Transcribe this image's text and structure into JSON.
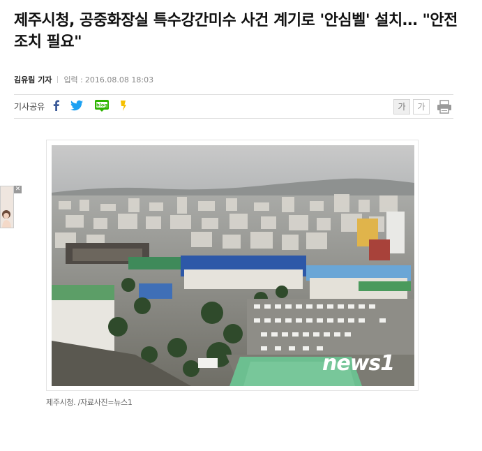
{
  "article": {
    "title": "제주시청, 공중화장실 특수강간미수 사건 계기로 '안심벨' 설치… \"안전조치 필요\"",
    "author": "김유림 기자",
    "date_label": "입력 :",
    "date": "2016.08.08 18:03"
  },
  "share": {
    "label": "기사공유",
    "icons": [
      "facebook-icon",
      "twitter-icon",
      "blog-icon",
      "kakaostory-icon"
    ],
    "blog_text": "blog"
  },
  "font_controls": {
    "larger": "가",
    "smaller": "가"
  },
  "photo": {
    "watermark": "news1",
    "caption": "제주시청. /자료사진=뉴스1"
  },
  "colors": {
    "facebook": "#3b5998",
    "twitter": "#1da1f2",
    "blog": "#2db400",
    "kakaostory": "#f6c000"
  }
}
